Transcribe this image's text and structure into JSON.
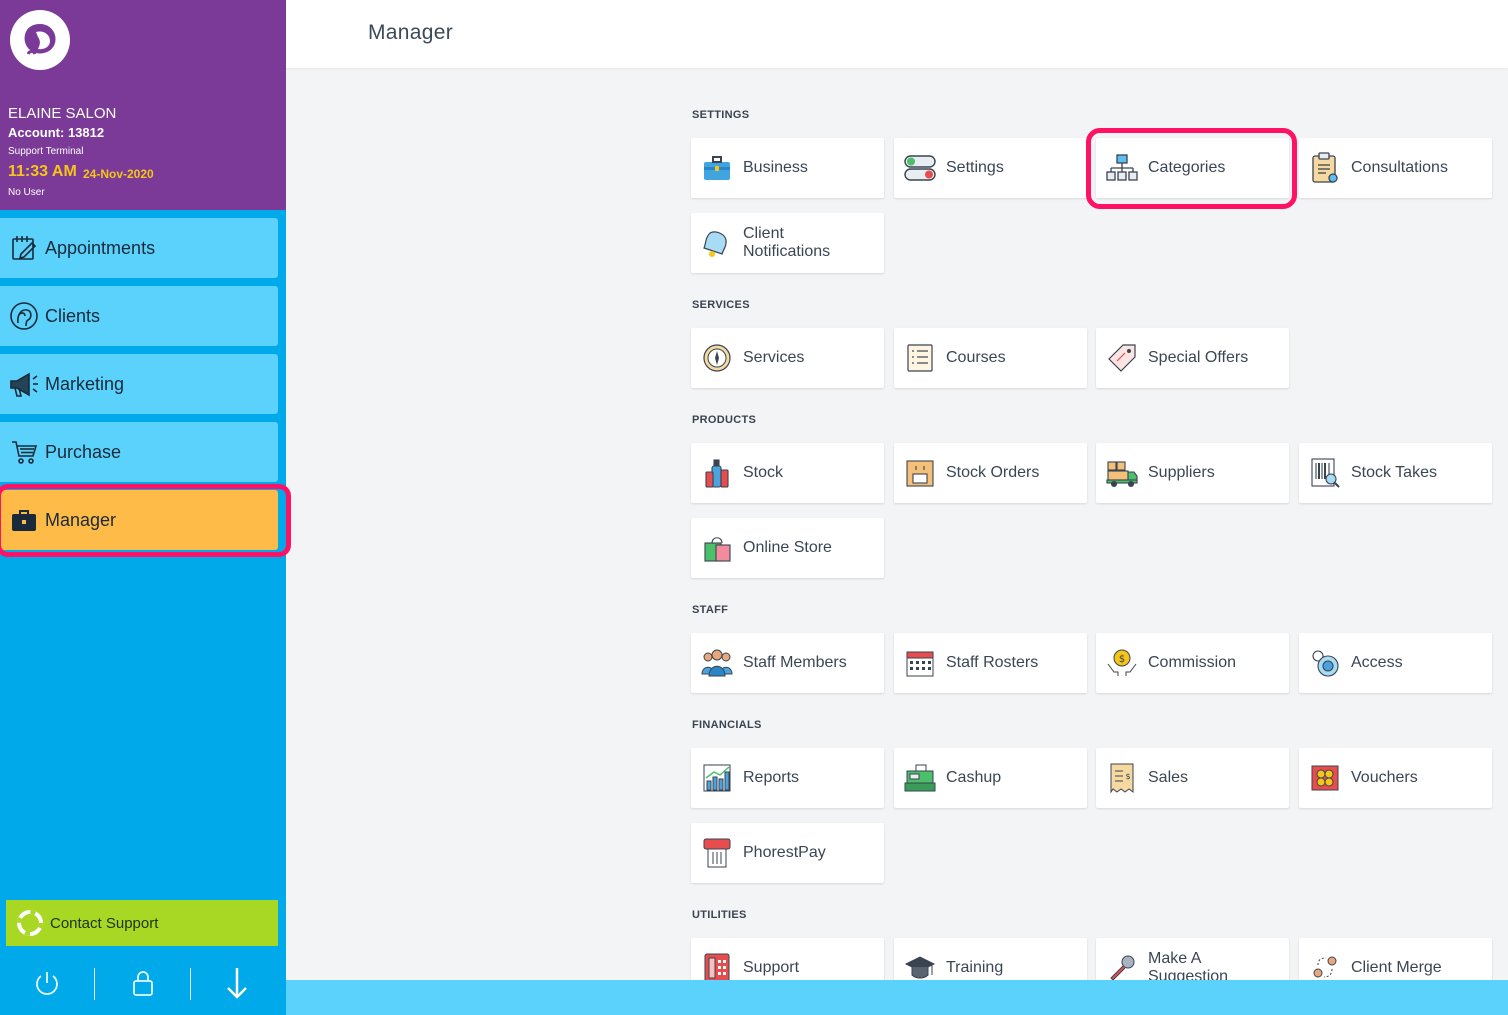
{
  "header": {
    "salon_name": "ELAINE SALON",
    "account": "Account: 13812",
    "terminal": "Support Terminal",
    "time": "11:33 AM",
    "date": "24-Nov-2020",
    "user": "No User"
  },
  "nav": {
    "items": [
      {
        "label": "Appointments",
        "icon": "calendar-edit-icon"
      },
      {
        "label": "Clients",
        "icon": "client-head-icon"
      },
      {
        "label": "Marketing",
        "icon": "megaphone-icon"
      },
      {
        "label": "Purchase",
        "icon": "cart-icon"
      },
      {
        "label": "Manager",
        "icon": "briefcase-icon",
        "active": true
      }
    ]
  },
  "contact_support": {
    "label": "Contact Support",
    "icon": "lifebuoy-icon"
  },
  "bottom_buttons": [
    "power-icon",
    "lock-icon",
    "arrow-down-icon"
  ],
  "topbar": {
    "title": "Manager"
  },
  "sections": [
    {
      "title": "SETTINGS",
      "tiles": [
        "Business",
        "Settings",
        "Categories",
        "Consultations",
        "Client Notifications"
      ]
    },
    {
      "title": "SERVICES",
      "tiles": [
        "Services",
        "Courses",
        "Special Offers"
      ]
    },
    {
      "title": "PRODUCTS",
      "tiles": [
        "Stock",
        "Stock Orders",
        "Suppliers",
        "Stock Takes",
        "Online Store"
      ]
    },
    {
      "title": "STAFF",
      "tiles": [
        "Staff Members",
        "Staff Rosters",
        "Commission",
        "Access"
      ]
    },
    {
      "title": "FINANCIALS",
      "tiles": [
        "Reports",
        "Cashup",
        "Sales",
        "Vouchers",
        "PhorestPay"
      ]
    },
    {
      "title": "UTILITIES",
      "tiles": [
        "Support",
        "Training",
        "Make A Suggestion",
        "Client Merge"
      ]
    }
  ],
  "colors": {
    "sidebar_header": "#7b3a98",
    "sidebar": "#00aaea",
    "nav_item": "#5bd2fb",
    "nav_active": "#ffbb47",
    "highlight": "#ff1164",
    "time": "#f5c518",
    "contact_support": "#a8d824"
  }
}
